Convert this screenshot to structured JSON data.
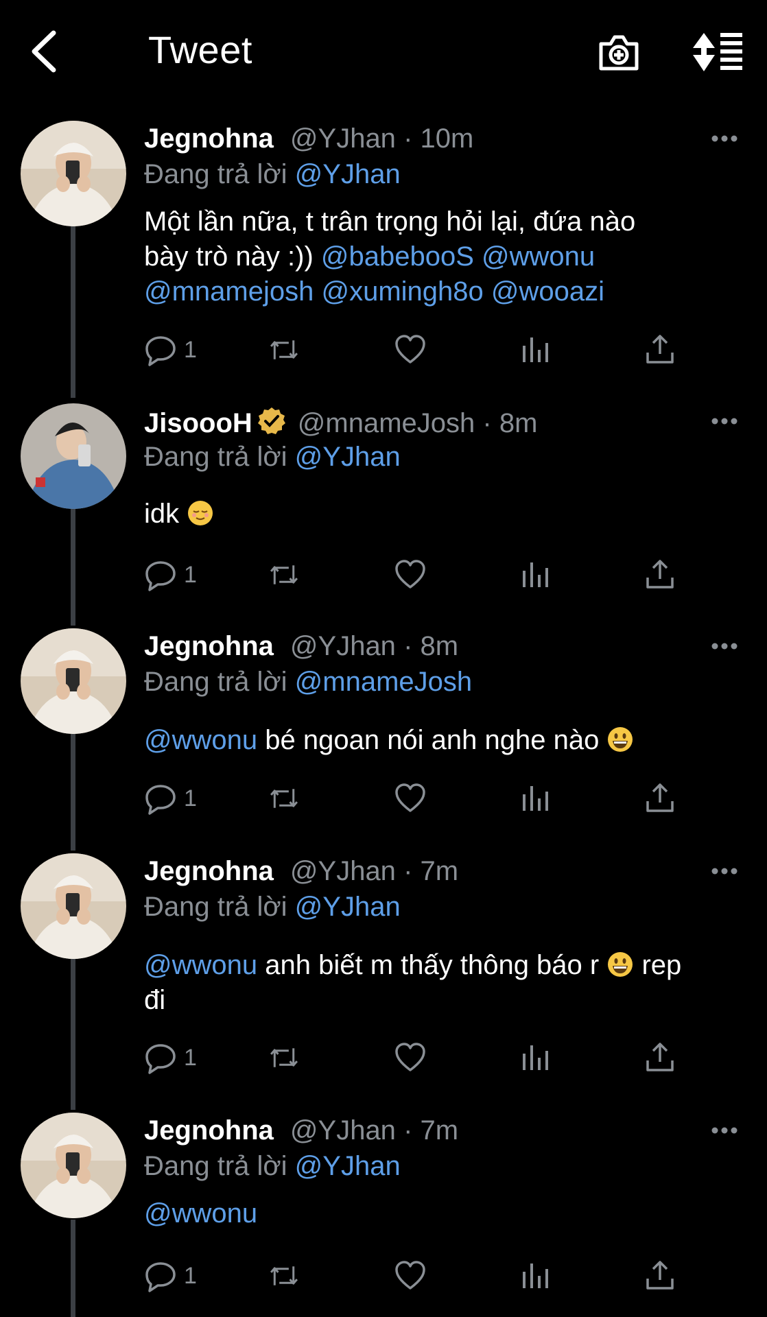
{
  "header": {
    "title": "Tweet",
    "back_icon": "chevron-left-icon",
    "camera_icon": "camera-plus-icon",
    "sort_icon": "sort-icon"
  },
  "colors": {
    "background": "#000000",
    "text": "#e7e9ea",
    "muted": "#8a8f95",
    "link": "#5e9fe8",
    "verified": "#e7b84a"
  },
  "reply_prefix": "Đang trả lời",
  "tweets": [
    {
      "name": "Jegnohna",
      "handle": "@YJhan",
      "time": "· 10m",
      "reply_to": "@YJhan",
      "text_line1": "Một lần nữa, t trân trọng hỏi lại, đứa nào",
      "text_line2_plain": "bày trò này :)) ",
      "mention1": "@babebooS",
      "mention2": "@wwonu",
      "mention3": "@mnamejosh",
      "mention4": "@xumingh8o",
      "mention5": "@wooazi",
      "replies": "1"
    },
    {
      "name": "JisoooH",
      "handle": "@mnameJosh",
      "time": "· 8m",
      "reply_to": "@YJhan",
      "text": "idk",
      "replies": "1",
      "verified": true
    },
    {
      "name": "Jegnohna",
      "handle": "@YJhan",
      "time": "· 8m",
      "reply_to": "@mnameJosh",
      "mention": "@wwonu",
      "text": " bé ngoan nói anh nghe nào ",
      "replies": "1"
    },
    {
      "name": "Jegnohna",
      "handle": "@YJhan",
      "time": "· 7m",
      "reply_to": "@YJhan",
      "mention": "@wwonu",
      "text_a": " anh biết m thấy thông báo r ",
      "text_b": " rep",
      "text_line2": "đi",
      "replies": "1"
    },
    {
      "name": "Jegnohna",
      "handle": "@YJhan",
      "time": "· 7m",
      "reply_to": "@YJhan",
      "mention": "@wwonu",
      "replies": "1"
    }
  ]
}
